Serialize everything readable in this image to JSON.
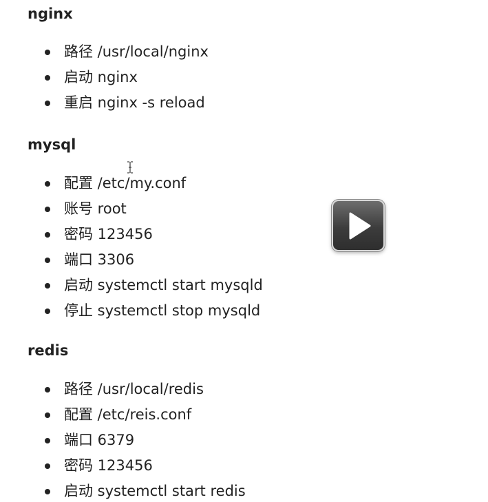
{
  "sections": [
    {
      "title": "nginx",
      "items": [
        "路径 /usr/local/nginx",
        "启动 nginx",
        "重启 nginx -s reload"
      ]
    },
    {
      "title": "mysql",
      "items": [
        "配置 /etc/my.conf",
        "账号 root",
        "密码 123456",
        "端口 3306",
        "启动 systemctl start mysqld",
        "停止 systemctl stop mysqld"
      ]
    },
    {
      "title": "redis",
      "items": [
        "路径 /usr/local/redis",
        "配置 /etc/reis.conf",
        "端口 6379",
        "密码 123456",
        "启动 systemctl start redis"
      ]
    }
  ],
  "icons": {
    "cursor": "text-cursor-icon",
    "play": "play-icon"
  },
  "colors": {
    "text": "#222222",
    "play_button": "#3c3c3c"
  }
}
